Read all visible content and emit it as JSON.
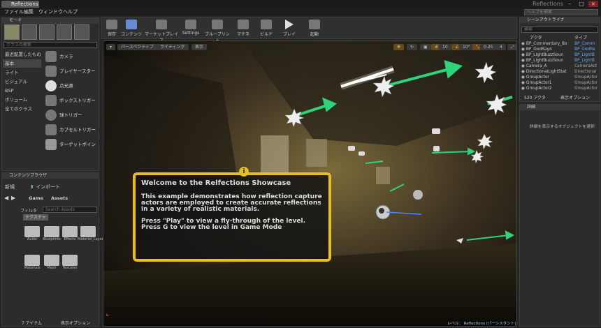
{
  "window": {
    "tab": "Reflections",
    "title": "Reflections"
  },
  "menu": [
    "ファイル",
    "編集",
    "ウィンドウ",
    "ヘルプ"
  ],
  "help_search": "ヘルプを検索",
  "modes": {
    "header": "モード",
    "search": "クラスの検索",
    "categories": [
      "最近配置したもの",
      "基本",
      "ライト",
      "ビジュアル",
      "BSP",
      "ボリューム",
      "全てのクラス"
    ],
    "items": [
      "カメラ",
      "プレイヤースター",
      "点光源",
      "ボックストリガー",
      "球トリガー",
      "カプセルトリガー",
      "ターゲットポイン"
    ]
  },
  "content_browser": {
    "header": "コンテンツブラウザ",
    "new": "新規",
    "import": "インポート",
    "path": [
      "Game",
      "Assets"
    ],
    "filter": "フィルタ",
    "search": "Search Assets",
    "tag": "テクスチャ",
    "folders": [
      "Audio",
      "Blueprints",
      "Effects",
      "Material_Layers",
      "Materials",
      "Mesh",
      "Textures"
    ],
    "count": "7 アイテム",
    "view_options": "表示オプション"
  },
  "toolbar": [
    "保存",
    "コンテンツ",
    "マーケットプレイス",
    "Settings",
    "ブループリント",
    "マチネ",
    "ビルド",
    "プレイ",
    "起動"
  ],
  "viewport": {
    "perspective": "パースペクティブ",
    "lit": "ライティング",
    "show": "表示",
    "grid": "10",
    "angle": "10°",
    "scale": "0.25",
    "cam": "4",
    "level_label": "レベル：",
    "level_name": "Reflections (パーシスタント)"
  },
  "welcome": {
    "title": "Welcome to the Relfections Showcase",
    "body": "This example demonstrates how reflection capture actors are employed to create accurate reflections in a variety of realistic materials.",
    "line1": "Press \"Play\" to view a fly-through of the level.",
    "line2": "Press G to view the level in Game Mode"
  },
  "outliner": {
    "header": "シーンアウトライナ",
    "search": "検索",
    "col1": "アクタ",
    "col2": "タイプ",
    "rows": [
      {
        "name": "BP_Commentary_Bo",
        "type": "BP_Comm"
      },
      {
        "name": "BP_GodRay4",
        "type": "BP_GodRa"
      },
      {
        "name": "BP_LightBuzzSoun",
        "type": "BP_LightB"
      },
      {
        "name": "BP_LightBuzzSoun",
        "type": "BP_LightB"
      },
      {
        "name": "Camera_A",
        "type": "CameraAct"
      },
      {
        "name": "DirectionalLightStat",
        "type": "Directional"
      },
      {
        "name": "GroupActor",
        "type": "GroupActor"
      },
      {
        "name": "GroupActor1",
        "type": "GroupActor"
      },
      {
        "name": "GroupActor2",
        "type": "GroupActor"
      }
    ],
    "count": "520 アクタ",
    "view_options": "表示オプション"
  },
  "details": {
    "header": "詳細",
    "message": "詳細を表示するオブジェクトを選択"
  }
}
